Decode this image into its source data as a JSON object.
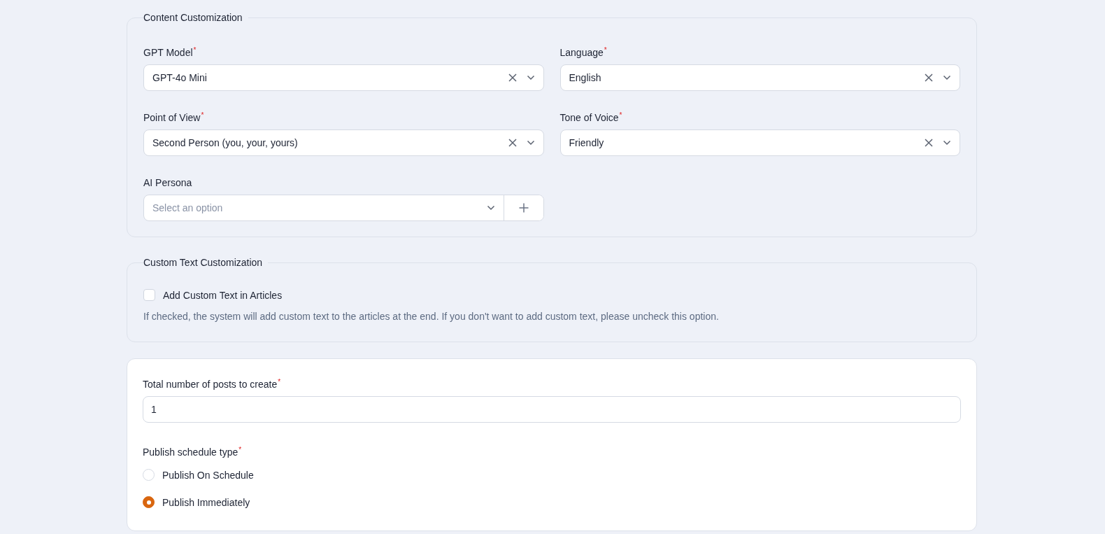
{
  "content_customization": {
    "legend": "Content Customization",
    "fields": [
      {
        "kind": "select",
        "label": "GPT Model",
        "required_mark": "*",
        "value": "GPT-4o Mini"
      },
      {
        "kind": "select",
        "label": "Language",
        "required_mark": "*",
        "value": "English"
      },
      {
        "kind": "select",
        "label": "Point of View",
        "required_mark": "*",
        "value": "Second Person (you, your, yours)"
      },
      {
        "kind": "select",
        "label": "Tone of Voice",
        "required_mark": "*",
        "value": "Friendly"
      },
      {
        "kind": "select-add",
        "label": "AI Persona",
        "placeholder": "Select an option"
      }
    ]
  },
  "custom_text": {
    "legend": "Custom Text Customization",
    "checkbox": {
      "label": "Add Custom Text in Articles",
      "checked": false
    },
    "help": "If checked, the system will add custom text to the articles at the end. If you don't want to add custom text, please uncheck this option."
  },
  "posts": {
    "count_field": {
      "label": "Total number of posts to create",
      "required_mark": "*",
      "value": "1"
    },
    "schedule": {
      "label": "Publish schedule type",
      "required_mark": "*",
      "options": [
        {
          "label": "Publish On Schedule",
          "selected": false
        },
        {
          "label": "Publish Immediately",
          "selected": true
        }
      ]
    }
  }
}
